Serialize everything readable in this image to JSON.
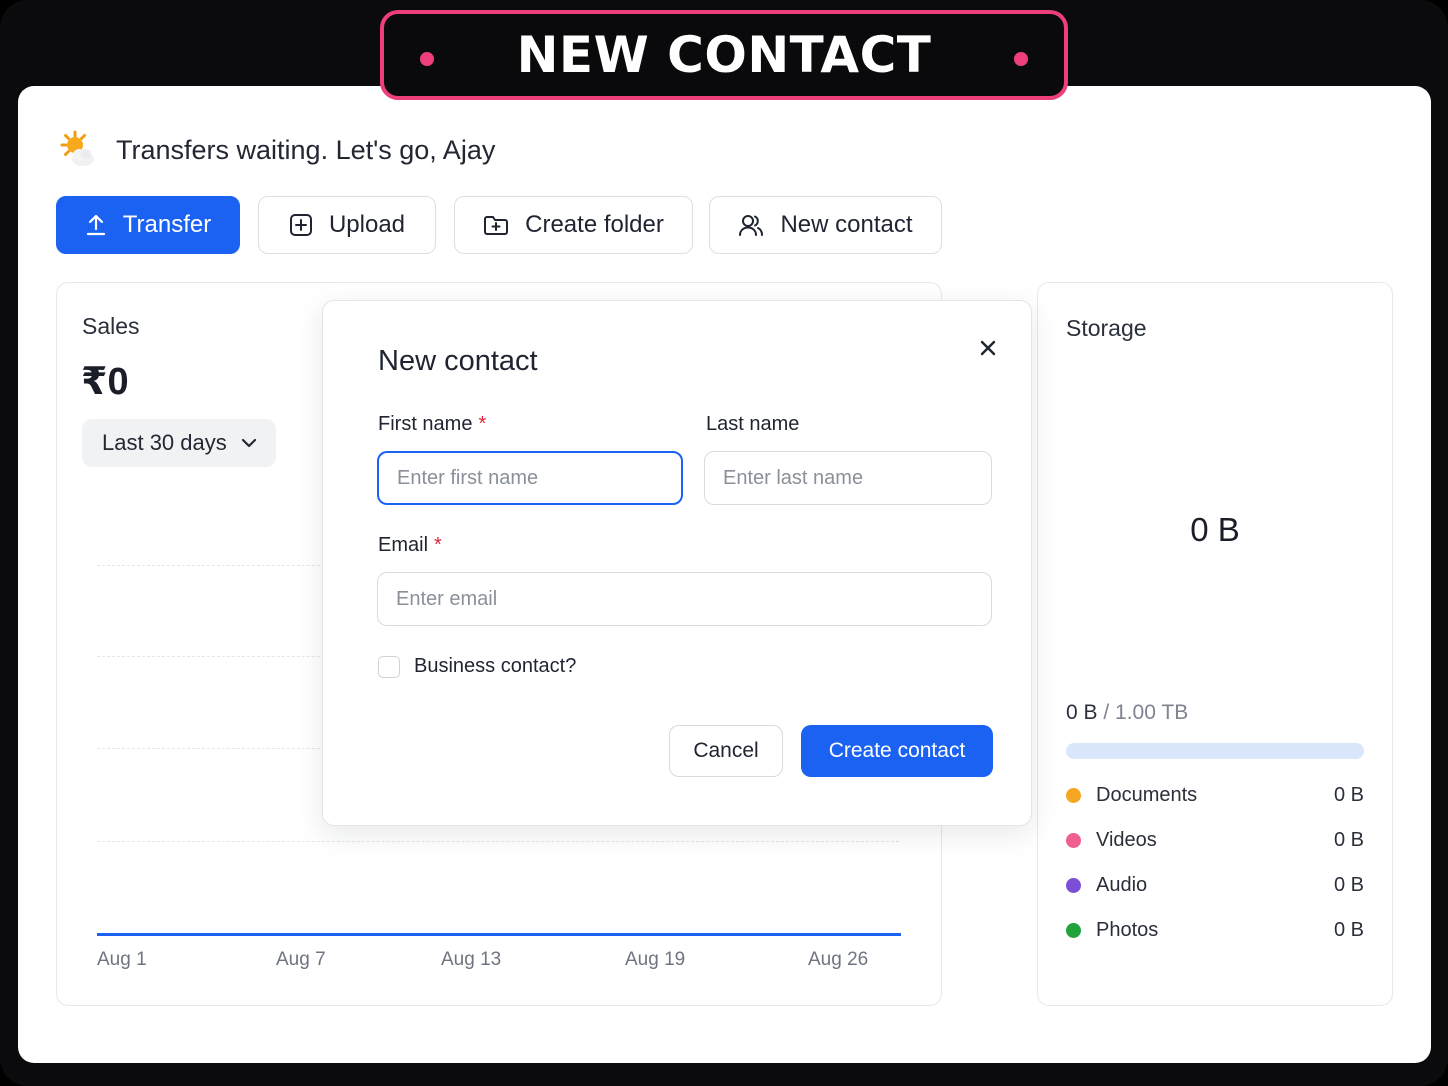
{
  "banner": {
    "title": "NEW CONTACT"
  },
  "greeting": {
    "icon": "sun-cloud-icon",
    "text": "Transfers waiting. Let's go, Ajay"
  },
  "toolbar": {
    "transfer_label": "Transfer",
    "upload_label": "Upload",
    "create_folder_label": "Create folder",
    "new_contact_label": "New contact"
  },
  "sales": {
    "title": "Sales",
    "value": "₹0",
    "range": "Last 30 days",
    "x_ticks": [
      "Aug 1",
      "Aug 7",
      "Aug 13",
      "Aug 19",
      "Aug 26"
    ]
  },
  "chart_data": {
    "type": "line",
    "x": [
      "Aug 1",
      "Aug 7",
      "Aug 13",
      "Aug 19",
      "Aug 26"
    ],
    "series": [
      {
        "values": [
          0,
          0,
          0,
          0,
          0
        ]
      }
    ],
    "grid": true,
    "color": "#1c62f2"
  },
  "storage": {
    "title": "Storage",
    "big_value": "0 B",
    "used": "0 B",
    "total_text": " / 1.00 TB",
    "used_fraction": 0,
    "categories": [
      {
        "label": "Documents",
        "value": "0 B",
        "color": "#f5a623"
      },
      {
        "label": "Videos",
        "value": "0 B",
        "color": "#f0608f"
      },
      {
        "label": "Audio",
        "value": "0 B",
        "color": "#7b4fd6"
      },
      {
        "label": "Photos",
        "value": "0 B",
        "color": "#1fa33a"
      }
    ]
  },
  "modal": {
    "title": "New contact",
    "first_name_label": "First name",
    "first_name_placeholder": "Enter first name",
    "last_name_label": "Last name",
    "last_name_placeholder": "Enter last name",
    "email_label": "Email",
    "email_placeholder": "Enter email",
    "required_mark": "*",
    "business_label": "Business contact?",
    "cancel_label": "Cancel",
    "create_label": "Create contact"
  }
}
